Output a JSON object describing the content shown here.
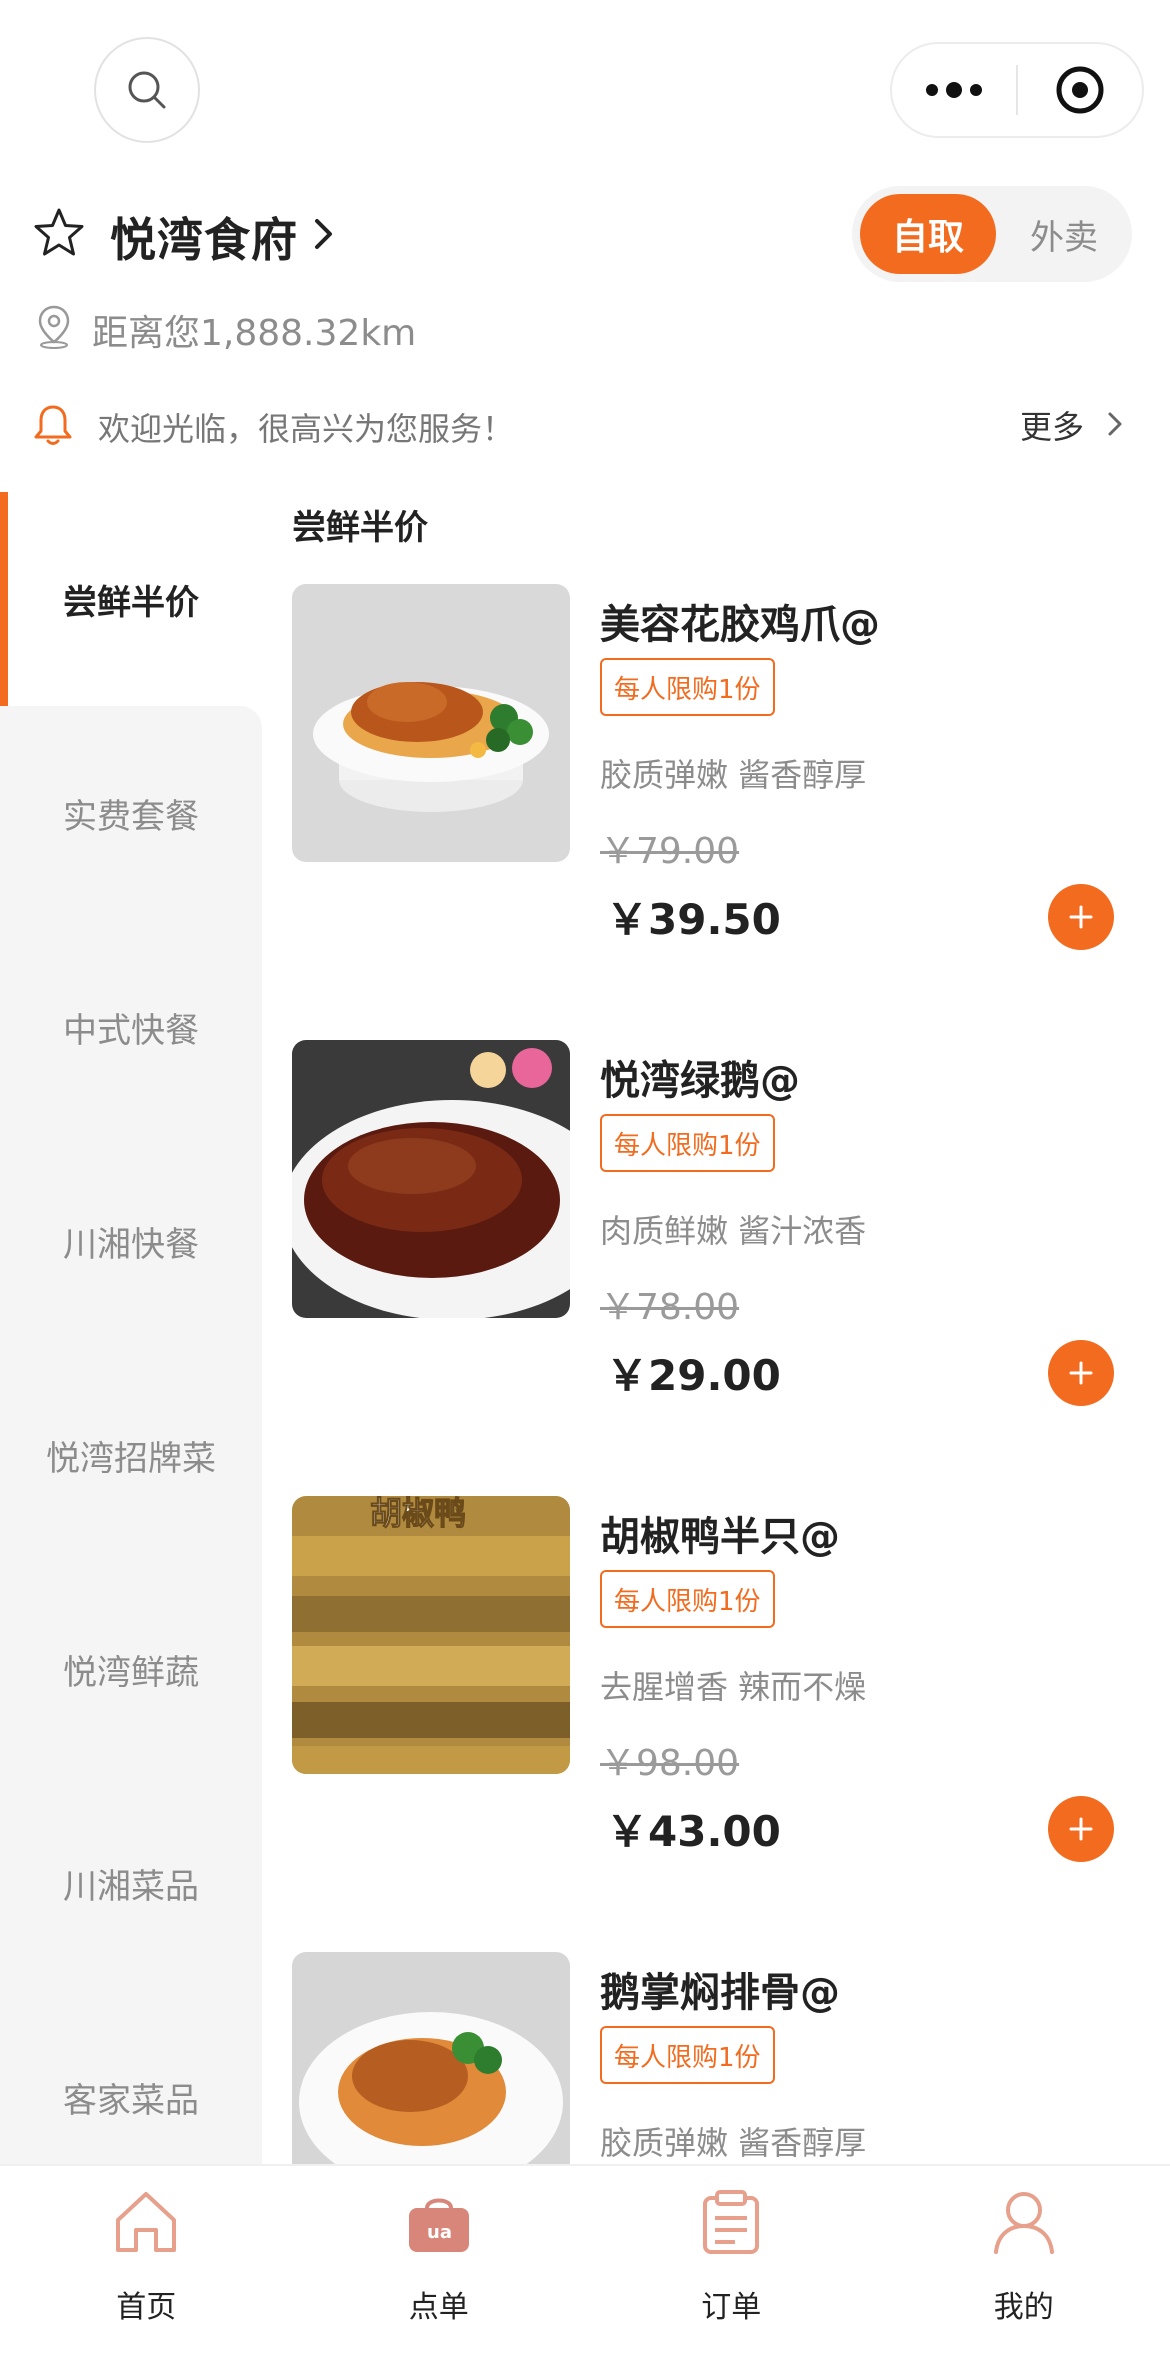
{
  "store": {
    "name": "悦湾食府",
    "distance": "距离您1,888.32km",
    "mode_active": "自取",
    "mode_inactive": "外卖"
  },
  "notice": {
    "text": "欢迎光临，很高兴为您服务！",
    "more": "更多"
  },
  "categories": [
    "尝鲜半价",
    "实费套餐",
    "中式快餐",
    "川湘快餐",
    "悦湾招牌菜",
    "悦湾鲜蔬",
    "川湘菜品",
    "客家菜品"
  ],
  "section": {
    "title": "尝鲜半价"
  },
  "items": [
    {
      "name": "美容花胶鸡爪@",
      "limit": "每人限购1份",
      "desc": "胶质弹嫩 酱香醇厚",
      "old_price": "￥79.00",
      "price": "￥39.50"
    },
    {
      "name": "悦湾绿鹅@",
      "limit": "每人限购1份",
      "desc": "肉质鲜嫩 酱汁浓香",
      "old_price": "￥78.00",
      "price": "￥29.00"
    },
    {
      "name": "胡椒鸭半只@",
      "limit": "每人限购1份",
      "desc": "去腥增香 辣而不燥",
      "old_price": "￥98.00",
      "price": "￥43.00",
      "image_text": "胡椒鸭"
    },
    {
      "name": "鹅掌焖排骨@",
      "limit": "每人限购1份",
      "desc": "胶质弹嫩 酱香醇厚"
    }
  ],
  "nav": {
    "home": "首页",
    "order": "点单",
    "orders": "订单",
    "mine": "我的"
  },
  "colors": {
    "accent": "#f26b1f",
    "sidebar_bg": "#f5f5f5"
  },
  "icons": [
    "search-icon",
    "more-dots-icon",
    "target-icon",
    "star-icon",
    "chevron-right-icon",
    "location-pin-icon",
    "bell-icon",
    "plus-icon",
    "home-icon",
    "bag-icon",
    "clipboard-icon",
    "user-icon"
  ]
}
